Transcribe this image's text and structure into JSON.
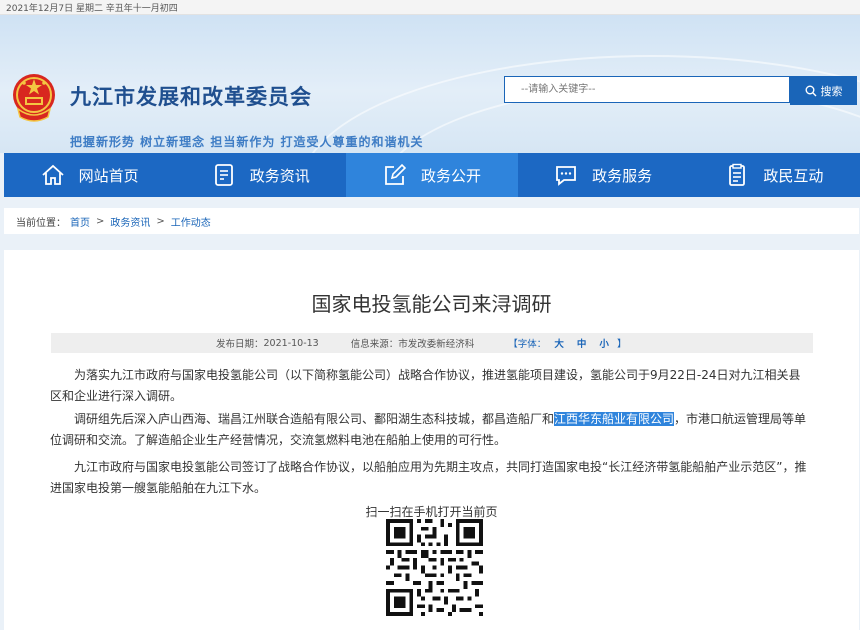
{
  "topbar": {
    "date_text": "2021年12月7日   星期二   辛丑年十一月初四"
  },
  "header": {
    "site_title": "九江市发展和改革委员会",
    "slogan": "把握新形势 树立新理念 担当新作为 打造受人尊重的和谐机关",
    "search": {
      "placeholder": "--请输入关键字--",
      "button_label": "搜索"
    }
  },
  "nav": {
    "items": [
      {
        "label": "网站首页",
        "icon": "home-icon"
      },
      {
        "label": "政务资讯",
        "icon": "document-list-icon"
      },
      {
        "label": "政务公开",
        "icon": "edit-icon"
      },
      {
        "label": "政务服务",
        "icon": "chat-icon"
      },
      {
        "label": "政民互动",
        "icon": "clipboard-icon"
      }
    ],
    "active_index": 2
  },
  "breadcrumb": {
    "label": "当前位置：",
    "items": [
      "首页",
      "政务资讯",
      "工作动态"
    ],
    "separator": ">"
  },
  "article": {
    "title": "国家电投氢能公司来浔调研",
    "publish_date_label": "发布日期：",
    "publish_date": "2021-10-13",
    "source_label": "信息来源：",
    "source": "市发改委新经济科",
    "font_label": "【字体：",
    "font_sizes": [
      "大",
      "中",
      "小"
    ],
    "font_close": "】",
    "paragraphs": [
      {
        "text": "为落实九江市政府与国家电投氢能公司（以下简称氢能公司）战略合作协议，推进氢能项目建设，氢能公司于9月22日-24日对九江相关县区和企业进行深入调研。"
      },
      {
        "before": "调研组先后深入庐山西海、瑞昌江州联合造船有限公司、鄱阳湖生态科技城，都昌造船厂和",
        "highlight": "江西华东船业有限公司",
        "after": "，市港口航运管理局等单位调研和交流。了解造船企业生产经营情况，交流氢燃料电池在船舶上使用的可行性。"
      },
      {
        "text": "九江市政府与国家电投氢能公司签订了战略合作协议，以船舶应用为先期主攻点，共同打造国家电投“长江经济带氢能船舶产业示范区”，推进国家电投第一艘氢能船舶在九江下水。"
      }
    ],
    "qr_caption": "扫一扫在手机打开当前页"
  },
  "colors": {
    "nav_bg": "#1c68c3",
    "nav_active": "#2f84dc",
    "title_blue": "#1f4f8f",
    "link_blue": "#1a65b8"
  }
}
